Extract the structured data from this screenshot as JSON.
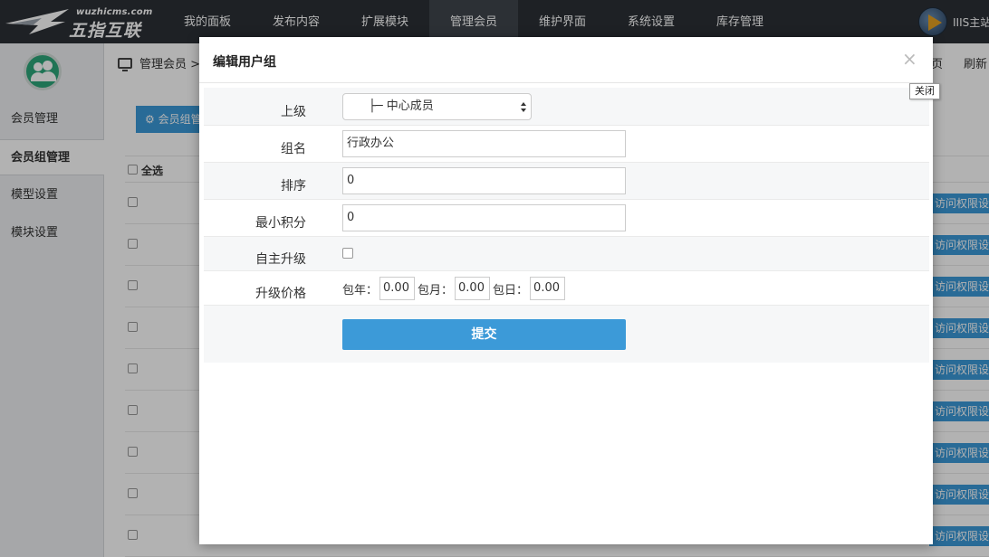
{
  "app": {
    "brand_small": "wuzhicms.com",
    "brand_big": "五指互联",
    "user_name": "IIIS主站"
  },
  "nav": {
    "items": [
      {
        "label": "我的面板",
        "active": false
      },
      {
        "label": "发布内容",
        "active": false
      },
      {
        "label": "扩展模块",
        "active": false
      },
      {
        "label": "管理会员",
        "active": true
      },
      {
        "label": "维护界面",
        "active": false
      },
      {
        "label": "系统设置",
        "active": false
      },
      {
        "label": "库存管理",
        "active": false
      }
    ]
  },
  "sidebar": {
    "items": [
      {
        "label": "会员管理",
        "active": false
      },
      {
        "label": "会员组管理",
        "active": true
      },
      {
        "label": "模型设置",
        "active": false
      },
      {
        "label": "模块设置",
        "active": false
      }
    ]
  },
  "background": {
    "breadcrumb": "管理会员 > 会",
    "crumb_home": "页",
    "crumb_refresh": "刷新",
    "action_button": "会员组管",
    "select_all": "全选",
    "perm_button": "访问权限设置"
  },
  "modal": {
    "title": "编辑用户组",
    "close_symbol": "×",
    "close_tooltip": "关闭",
    "fields": {
      "parent_label": "上级",
      "parent_value": "├─ 中心成员",
      "name_label": "组名",
      "name_value": "行政办公",
      "order_label": "排序",
      "order_value": "0",
      "min_points_label": "最小积分",
      "min_points_value": "0",
      "self_upgrade_label": "自主升级",
      "upgrade_price_label": "升级价格",
      "per_year_label": "包年：",
      "per_year_value": "0.00",
      "per_month_label": "包月：",
      "per_month_value": "0.00",
      "per_day_label": "包日：",
      "per_day_value": "0.00"
    },
    "submit_label": "提交"
  }
}
